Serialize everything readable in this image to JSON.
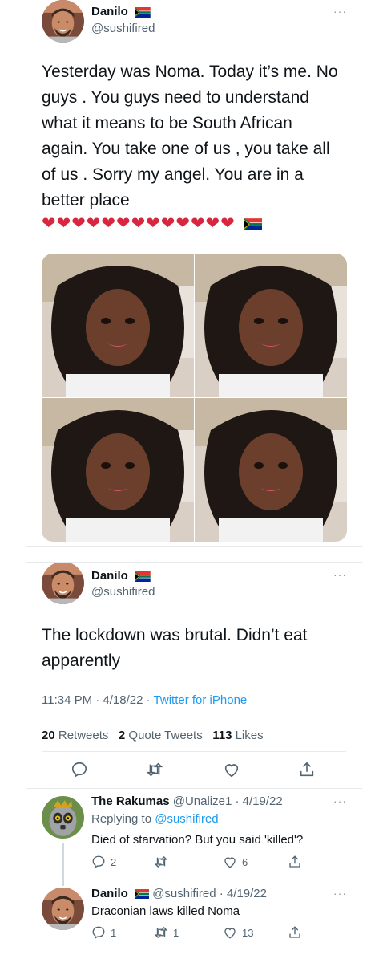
{
  "tweet1": {
    "name": "Danilo",
    "handle": "@sushifired",
    "more": "···",
    "lines": [
      "Yesterday was Noma. Today it’s me. No",
      "guys . You guys need to understand",
      "what it means to be South African",
      "again. You take one of us , you take all",
      "of us . Sorry my angel. You are in a",
      "better place"
    ],
    "hearts": "❤❤❤❤❤❤❤❤❤❤❤❤❤"
  },
  "tweet2": {
    "name": "Danilo",
    "handle": "@sushifired",
    "more": "···",
    "lines": [
      "The lockdown was brutal. Didn’t eat",
      "apparently"
    ],
    "time": "11:34 PM · 4/18/22 · ",
    "source": "Twitter for iPhone",
    "retweets_count": "20",
    "retweets_label": "Retweets",
    "quotes_count": "2",
    "quotes_label": "Quote Tweets",
    "likes_count": "113",
    "likes_label": "Likes"
  },
  "reply1": {
    "name": "The Rakumas",
    "handle_date": "@Unalize1 · 4/19/22",
    "more": "···",
    "replying_prefix": "Replying to ",
    "replying_to": "@sushifired",
    "text": "Died of starvation? But you said 'killed'?",
    "replies": "2",
    "retweets": "",
    "likes": "6"
  },
  "reply2": {
    "name": "Danilo",
    "handle_date": "@sushifired · 4/19/22",
    "more": "···",
    "text": "Draconian laws killed Noma",
    "replies": "1",
    "retweets": "1",
    "likes": "13"
  },
  "colors": {
    "link": "#1d9bf0",
    "secondary": "#536471",
    "heart": "#d7263d"
  }
}
